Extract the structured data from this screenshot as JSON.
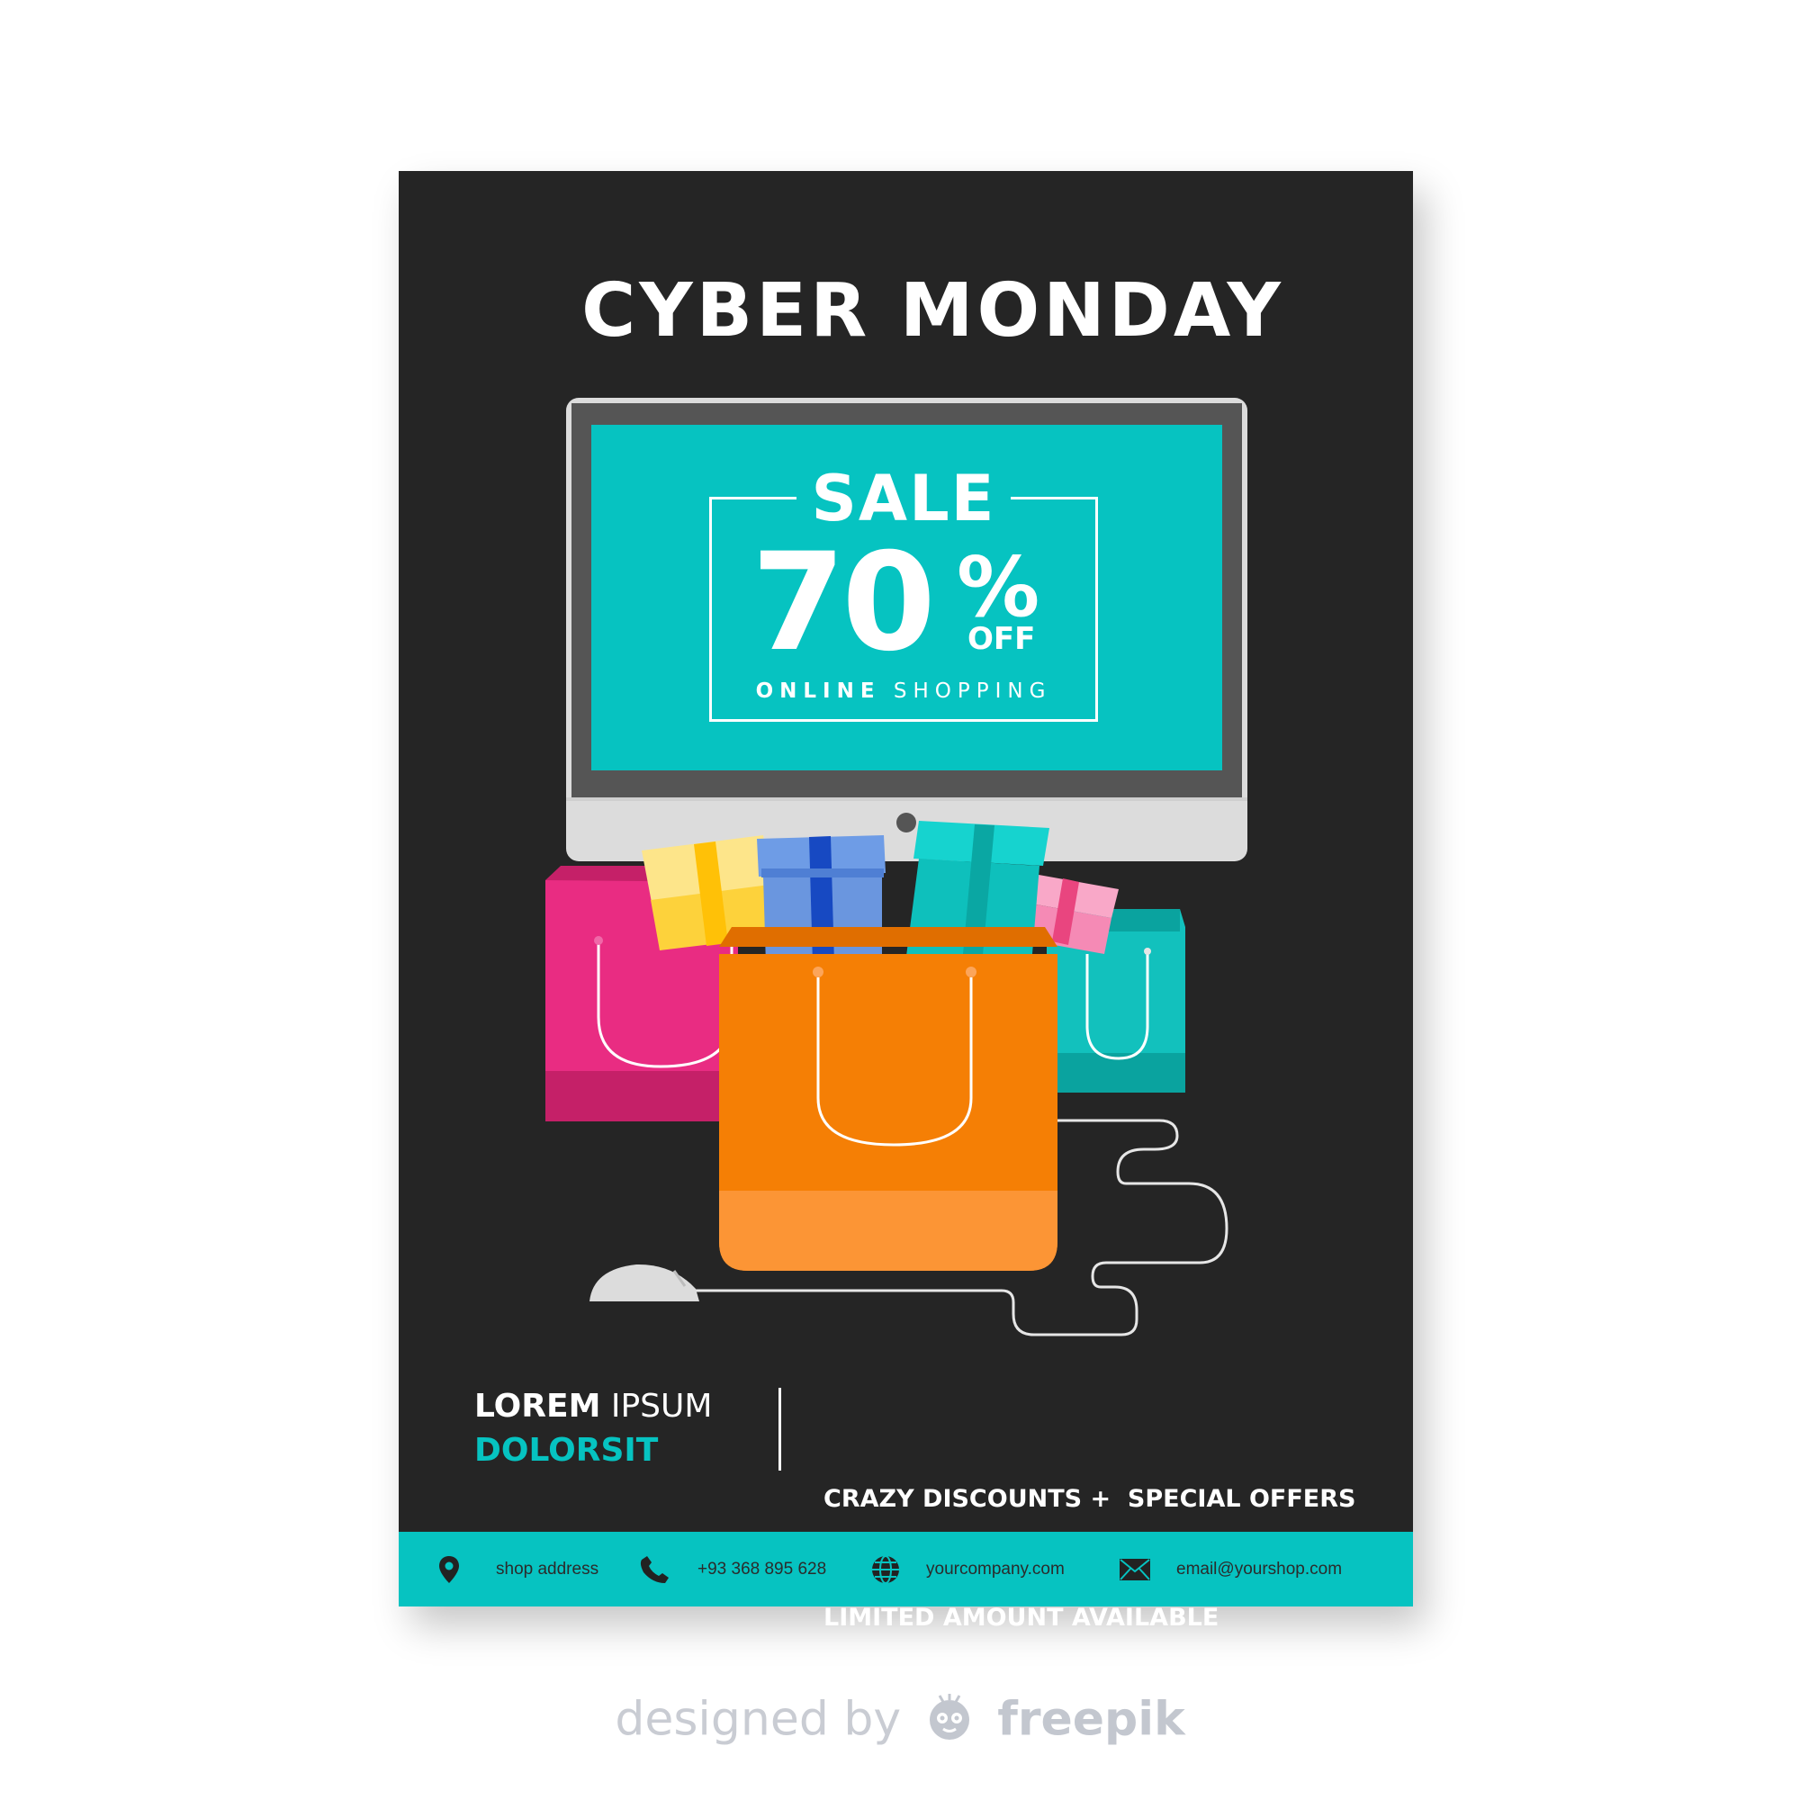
{
  "flyer": {
    "title": "CYBER MONDAY",
    "sale": {
      "word": "SALE",
      "number": "70",
      "percent": "%",
      "off": "OFF",
      "online_bold": "ONLINE",
      "online_rest": " SHOPPING"
    },
    "info_left": {
      "line1_bold": "LOREM",
      "line1_rest": " IPSUM",
      "line2": "DOLORSIT"
    },
    "info_right": {
      "line1": "CRAZY DISCOUNTS +  SPECIAL OFFERS",
      "line2": "LIMITED AMOUNT AVAILABLE"
    },
    "footer": {
      "address": "shop address",
      "phone": "+93 368 895 628",
      "website": "yourcompany.com",
      "email": "email@yourshop.com"
    }
  },
  "credit": {
    "designed_by": "designed by",
    "brand": "freepik"
  },
  "colors": {
    "background": "#252525",
    "accent": "#06c3c1",
    "pink_bag": "#e92c82",
    "orange_bag": "#f57f05",
    "teal_bag": "#12c1bd"
  }
}
